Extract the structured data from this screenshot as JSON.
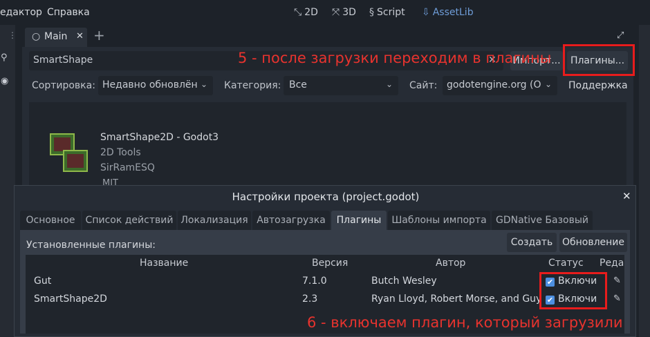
{
  "menu": {
    "editor": "едактор",
    "help": "Справка"
  },
  "workspaces": {
    "w2d": "2D",
    "w3d": "3D",
    "script": "Script",
    "assetlib": "AssetLib"
  },
  "editor_tab": {
    "label": "Main",
    "close": "✕",
    "add": "+"
  },
  "assetlib": {
    "search_value": "SmartShape",
    "import_label": "Импорт...",
    "plugins_button": "Плагины...",
    "sort_label": "Сортировка:",
    "sort_value": "Недавно обновлён",
    "category_label": "Категория:",
    "category_value": "Все",
    "site_label": "Сайт:",
    "site_value": "godotengine.org (O",
    "support_label": "Поддержка",
    "asset": {
      "title": "SmartShape2D - Godot3",
      "category": "2D Tools",
      "author": "SirRamESQ",
      "license": "MIT"
    }
  },
  "annotations": {
    "a5": "5 - после загрузки переходим в плагины",
    "a6": "6 - включаем плагин, который загрузили"
  },
  "dialog": {
    "title": "Настройки проекта (project.godot)",
    "close": "✕",
    "tabs": [
      "Основное",
      "Список действий",
      "Локализация",
      "Автозагрузка",
      "Плагины",
      "Шаблоны импорта",
      "GDNative Базовый"
    ],
    "installed_label": "Установленные плагины:",
    "create_button": "Создать",
    "update_button": "Обновление",
    "columns": {
      "name": "Название",
      "version": "Версия",
      "author": "Автор",
      "status": "Статус",
      "edit": "Реда"
    },
    "rows": [
      {
        "name": "Gut",
        "version": "7.1.0",
        "author": "Butch Wesley",
        "status": "Включи"
      },
      {
        "name": "SmartShape2D",
        "version": "2.3",
        "author": "Ryan Lloyd, Robert Morse, and Guy",
        "status": "Включи"
      }
    ]
  },
  "colors": {
    "annotation": "#e8332e",
    "accent": "#4d8fe0"
  }
}
